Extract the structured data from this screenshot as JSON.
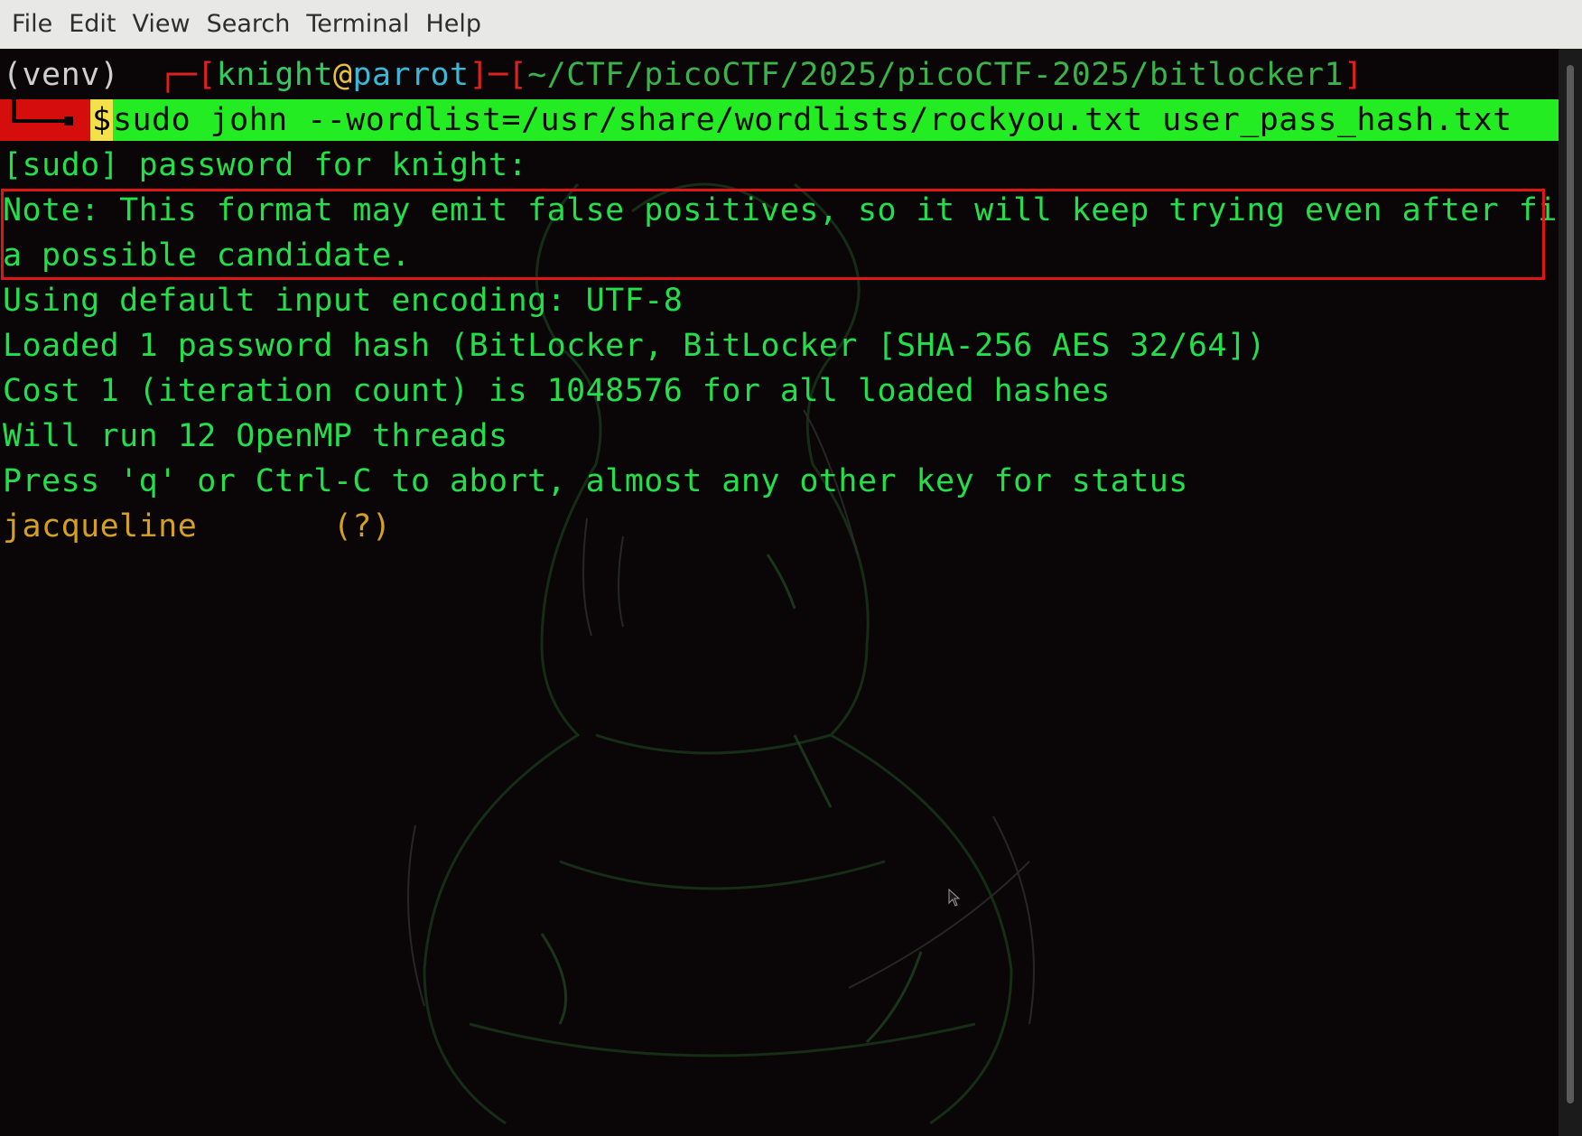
{
  "menubar": {
    "items": [
      "File",
      "Edit",
      "View",
      "Search",
      "Terminal",
      "Help"
    ]
  },
  "prompt": {
    "venv": "(venv) ",
    "corner": "┌─",
    "open_bracket": "[",
    "user": "knight",
    "at": "@",
    "host": "parrot",
    "sep": "]─[",
    "path": "~/CTF/picoCTF/2025/picoCTF-2025/bitlocker1",
    "close_bracket": "]"
  },
  "command": {
    "dollar": "$",
    "text": "sudo john --wordlist=/usr/share/wordlists/rockyou.txt user_pass_hash.txt"
  },
  "output": {
    "sudo_prompt": "[sudo] password for knight: ",
    "note_line1": "Note: This format may emit false positives, so it will keep trying even after finding",
    "note_line2": "a possible candidate.",
    "encoding": "Using default input encoding: UTF-8",
    "loaded": "Loaded 1 password hash (BitLocker, BitLocker [SHA-256 AES 32/64])",
    "cost": "Cost 1 (iteration count) is 1048576 for all loaded hashes",
    "threads": "Will run 12 OpenMP threads",
    "press": "Press 'q' or Ctrl-C to abort, almost any other key for status",
    "found_password": "jacqueline",
    "found_user": "       (?)"
  },
  "colors": {
    "terminal_bg": "#0a0607",
    "output_text": "#23e04a",
    "command_highlight": "#23ec23",
    "prompt_red": "#d60d0d",
    "found_text": "#d4a024",
    "annotation_box": "#e01616"
  },
  "icons": {
    "pointer": "mouse-pointer-icon"
  }
}
